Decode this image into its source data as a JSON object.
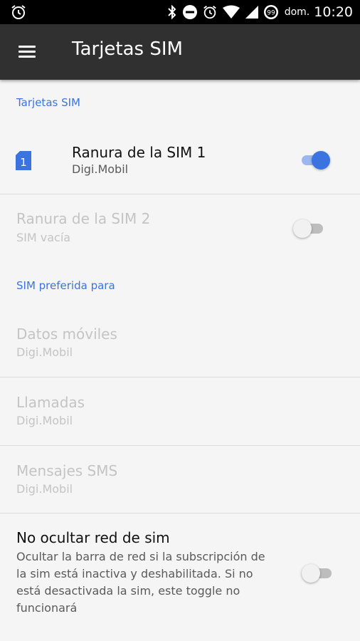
{
  "status_bar": {
    "carrier_label": "dom.",
    "time": "10:20",
    "badge": "99",
    "icons": [
      "alarm-icon",
      "bluetooth-icon",
      "do-not-disturb-icon",
      "alarm-icon",
      "wifi-icon",
      "signal-icon",
      "badge-icon"
    ]
  },
  "app_bar": {
    "title": "Tarjetas SIM",
    "menu_icon": "hamburger-menu-icon"
  },
  "sections": {
    "sim_cards": {
      "header": "Tarjetas SIM"
    },
    "preferred": {
      "header": "SIM preferida para"
    }
  },
  "sim_slots": [
    {
      "title": "Ranura de la SIM 1",
      "subtitle": "Digi.Mobil",
      "icon_number": "1",
      "enabled": true,
      "toggle": "on"
    },
    {
      "title": "Ranura de la SIM 2",
      "subtitle": "SIM vacía",
      "enabled": false,
      "toggle": "off"
    }
  ],
  "preferred_items": [
    {
      "title": "Datos móviles",
      "subtitle": "Digi.Mobil"
    },
    {
      "title": "Llamadas",
      "subtitle": "Digi.Mobil"
    },
    {
      "title": "Mensajes SMS",
      "subtitle": "Digi.Mobil"
    }
  ],
  "hide_network": {
    "title": "No ocultar red de sim",
    "description": "Ocultar la barra de red si la subscripción de la sim está inactiva y deshabilitada. Si no está desactivada la sim, este toggle no funcionará",
    "toggle": "off"
  },
  "colors": {
    "accent": "#3b73e0",
    "app_bar": "#303030",
    "status_bar": "#000000",
    "background": "#f5f5f5"
  }
}
